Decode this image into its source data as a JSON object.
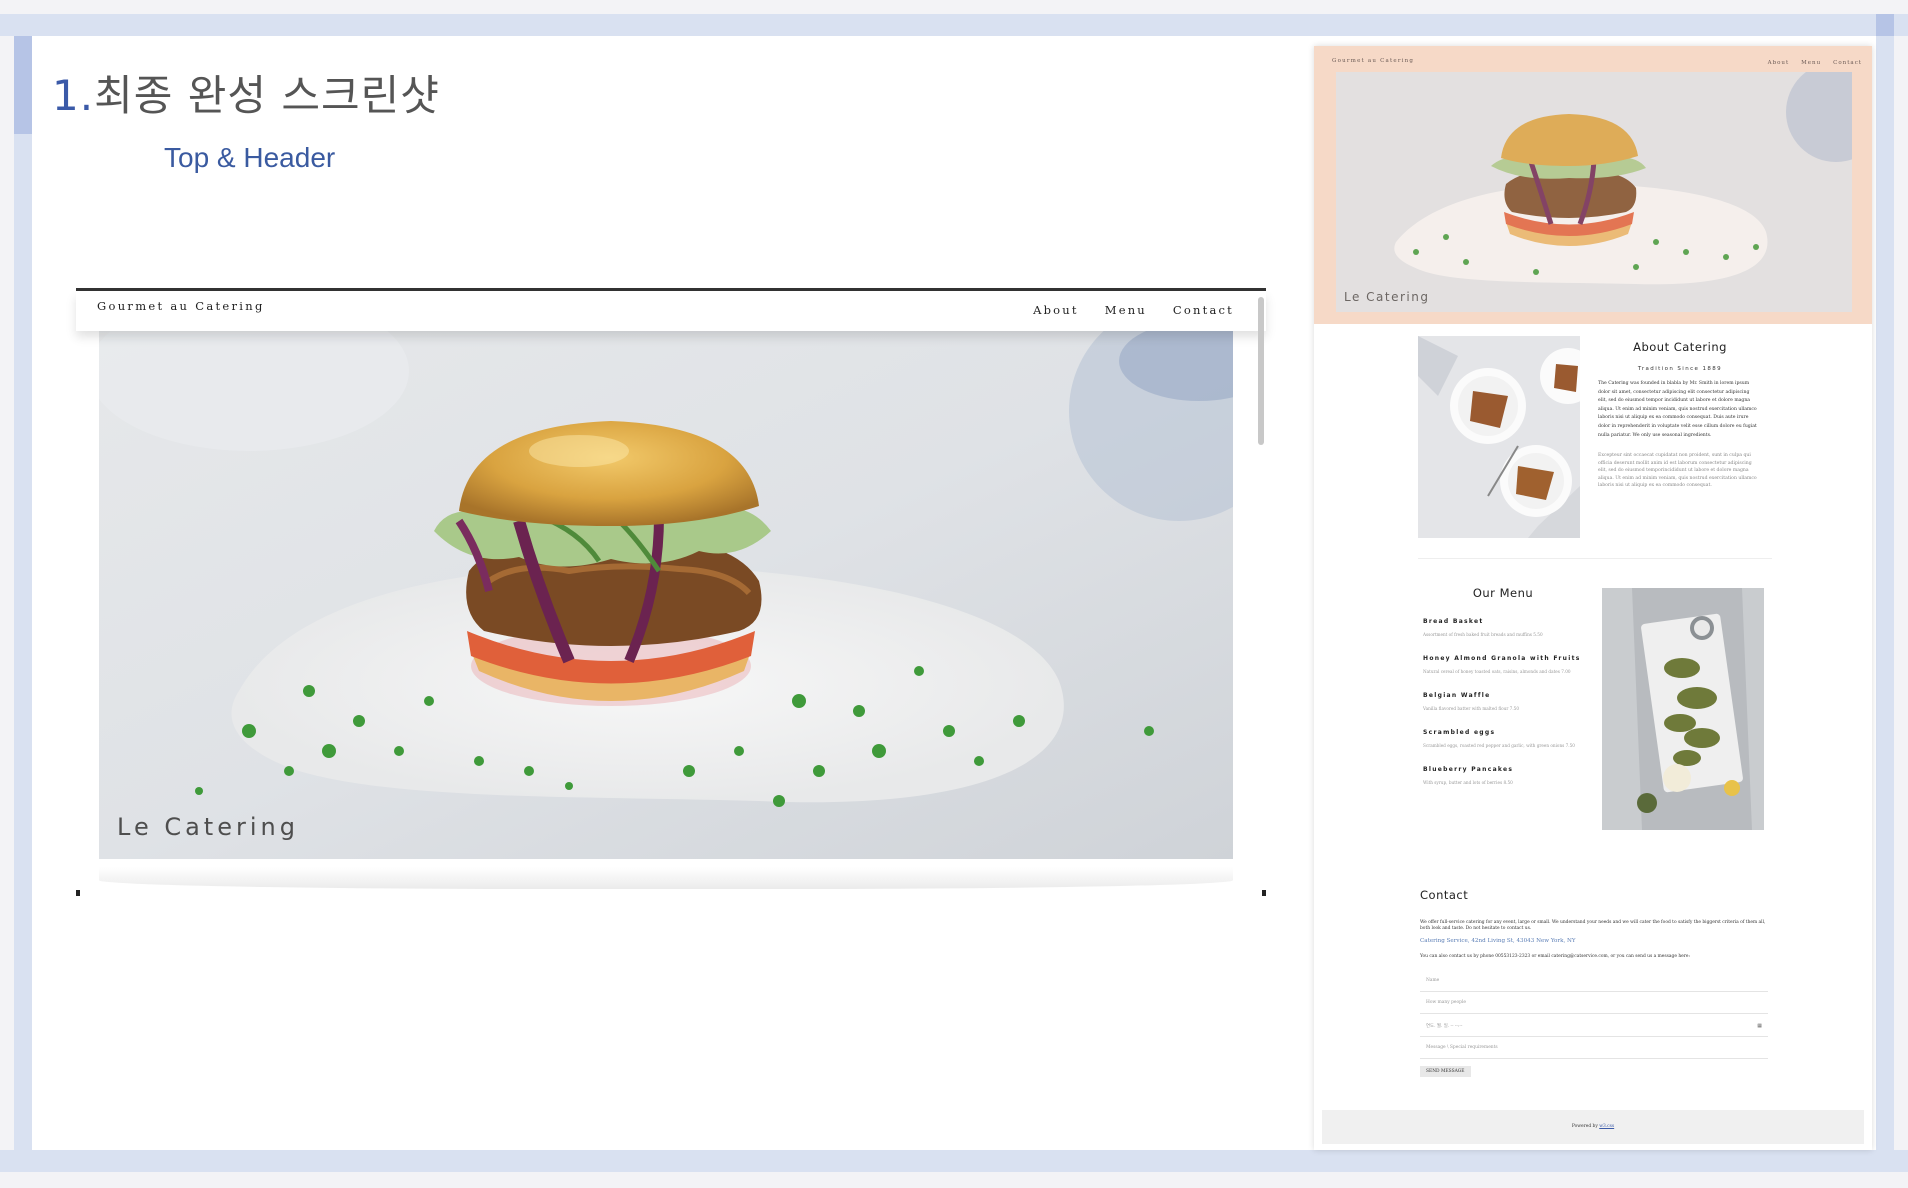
{
  "slide": {
    "title_num": "1.",
    "title_text": "최종 완성 스크린샷",
    "subtitle": "Top & Header"
  },
  "mock": {
    "brand": "Gourmet au Catering",
    "nav": [
      "About",
      "Menu",
      "Contact"
    ],
    "hero_caption": "Le Catering"
  },
  "preview": {
    "brand": "Gourmet au Catering",
    "nav": [
      "About",
      "Menu",
      "Contact"
    ],
    "hero_caption": "Le Catering",
    "about": {
      "title": "About Catering",
      "subtitle": "Tradition Since 1889",
      "text": "The Catering was founded in blabla by Mr. Smith in lorem ipsum dolor sit amet, consectetur adipiscing elit consectetur adipiscing elit, sed do eiusmod tempor incididunt ut labore et dolore magna aliqua. Ut enim ad minim veniam, quis nostrud exercitation ullamco laboris nisi ut aliquip ex ea commodo consequat. Duis aute irure dolor in reprehenderit in voluptate velit esse cillum dolore eu fugiat nulla pariatur. We only use seasonal ingredients.",
      "text2": "Excepteur sint occaecat cupidatat non proident, sunt in culpa qui officia deserunt mollit anim id est laborum consectetur adipiscing elit, sed do eiusmod temporincididunt ut labore et dolore magna aliqua. Ut enim ad minim veniam, quis nostrud exercitation ullamco laboris nisi ut aliquip ex ea commodo consequat."
    },
    "menu": {
      "title": "Our Menu",
      "items": [
        {
          "name": "Bread Basket",
          "desc": "Assortment of fresh baked fruit breads and muffins 5.50"
        },
        {
          "name": "Honey Almond Granola with Fruits",
          "desc": "Natural cereal of honey toasted oats, raisins, almonds and dates 7.00"
        },
        {
          "name": "Belgian Waffle",
          "desc": "Vanilla flavored batter with malted flour 7.50"
        },
        {
          "name": "Scrambled eggs",
          "desc": "Scrambled eggs, roasted red pepper and garlic, with green onions 7.50"
        },
        {
          "name": "Blueberry Pancakes",
          "desc": "With syrup, butter and lots of berries 8.50"
        }
      ]
    },
    "contact": {
      "title": "Contact",
      "text": "We offer full-service catering for any event, large or small. We understand your needs and we will cater the food to satisfy the biggerst criteria of them all, both look and taste. Do not hesitate to contact us.",
      "address": "Catering Service, 42nd Living St, 43043 New York, NY",
      "text2": "You can also contact us by phone 00553123-2323 or email catering@catservice.com, or you can send us a message here:",
      "fields": [
        "Name",
        "How many people",
        "연도. 월. 일. -- --:--",
        "Message \\ Special requirements"
      ],
      "send": "SEND MESSAGE"
    },
    "footer": {
      "prefix": "Powered by",
      "link": "w3.css"
    }
  }
}
